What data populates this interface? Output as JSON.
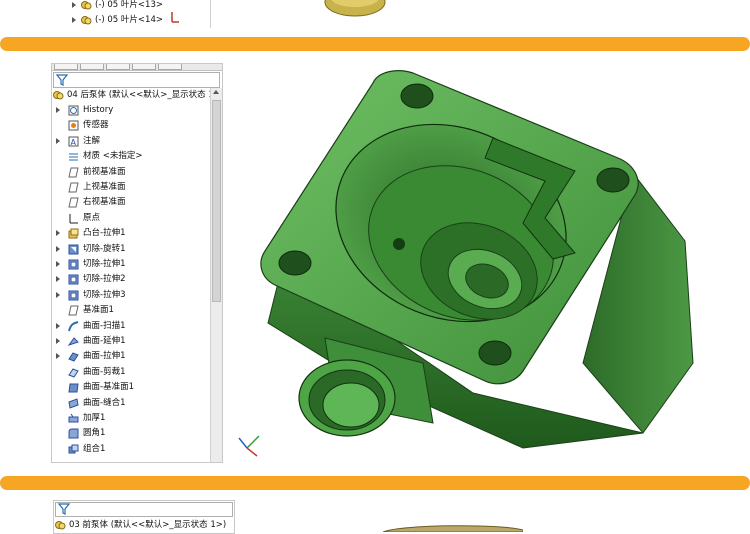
{
  "top_panel": {
    "items": [
      {
        "label": "(-) 05 叶片<13>"
      },
      {
        "label": "(-) 05 叶片<14>"
      }
    ]
  },
  "middle_panel": {
    "root_label": "04 后泵体  (默认<<默认>_显示状态 1>)",
    "items": [
      {
        "label": "History",
        "icon": "history-icon",
        "arrow": true
      },
      {
        "label": "传感器",
        "icon": "sensor-icon",
        "arrow": false
      },
      {
        "label": "注解",
        "icon": "annotation-icon",
        "arrow": true
      },
      {
        "label": "材质 <未指定>",
        "icon": "material-icon",
        "arrow": false
      },
      {
        "label": "前视基准面",
        "icon": "plane-icon",
        "arrow": false
      },
      {
        "label": "上视基准面",
        "icon": "plane-icon",
        "arrow": false
      },
      {
        "label": "右视基准面",
        "icon": "plane-icon",
        "arrow": false
      },
      {
        "label": "原点",
        "icon": "origin-icon",
        "arrow": false
      },
      {
        "label": "凸台-拉伸1",
        "icon": "boss-extrude-icon",
        "arrow": true
      },
      {
        "label": "切除-旋转1",
        "icon": "cut-revolve-icon",
        "arrow": true
      },
      {
        "label": "切除-拉伸1",
        "icon": "cut-extrude-icon",
        "arrow": true
      },
      {
        "label": "切除-拉伸2",
        "icon": "cut-extrude-icon",
        "arrow": true
      },
      {
        "label": "切除-拉伸3",
        "icon": "cut-extrude-icon",
        "arrow": true
      },
      {
        "label": "基准面1",
        "icon": "plane-icon",
        "arrow": false
      },
      {
        "label": "曲面-扫描1",
        "icon": "surface-sweep-icon",
        "arrow": true
      },
      {
        "label": "曲面-延伸1",
        "icon": "surface-extend-icon",
        "arrow": true
      },
      {
        "label": "曲面-拉伸1",
        "icon": "surface-extrude-icon",
        "arrow": true
      },
      {
        "label": "曲面-剪裁1",
        "icon": "surface-trim-icon",
        "arrow": false
      },
      {
        "label": "曲面-基准面1",
        "icon": "surface-plane-icon",
        "arrow": false
      },
      {
        "label": "曲面-缝合1",
        "icon": "surface-knit-icon",
        "arrow": false
      },
      {
        "label": "加厚1",
        "icon": "thicken-icon",
        "arrow": false
      },
      {
        "label": "圆角1",
        "icon": "fillet-icon",
        "arrow": false
      },
      {
        "label": "组合1",
        "icon": "combine-icon",
        "arrow": false
      }
    ]
  },
  "bottom_panel": {
    "root_label": "03 前泵体  (默认<<默认>_显示状态 1>)"
  },
  "colors": {
    "band": "#f6a623",
    "part_green": "#3f8f3a",
    "part_green_light": "#6fc064",
    "part_green_dark": "#1f5a1c",
    "brass": "#c8b24a"
  }
}
